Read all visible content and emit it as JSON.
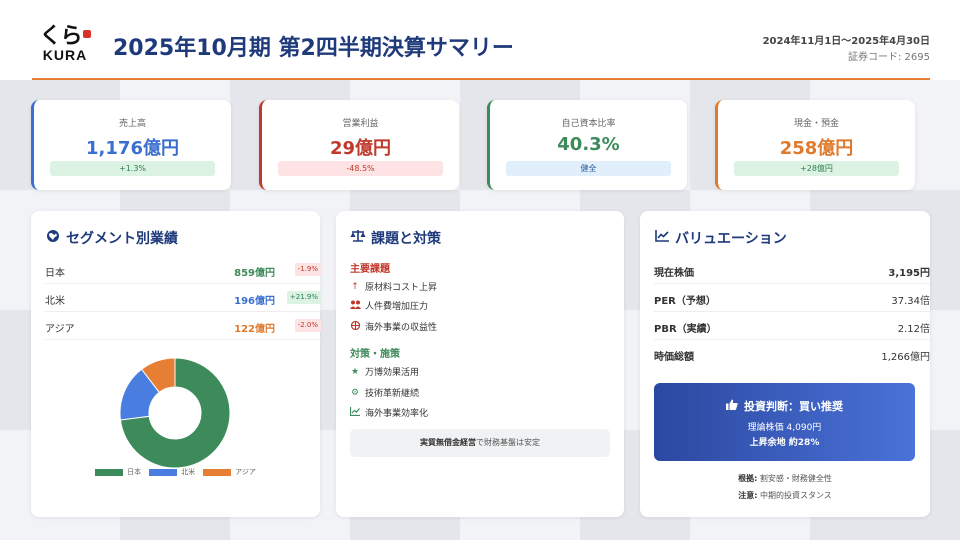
{
  "header": {
    "logo_mark": "くら",
    "logo_word": "KURA",
    "title": "2025年10月期 第2四半期決算サマリー",
    "period": "2024年11月1日～2025年4月30日",
    "code": "証券コード: 2695"
  },
  "kpis": [
    {
      "label": "売上高",
      "value": "1,176億円",
      "badge": "+1.3%",
      "color": "#3b6fcf"
    },
    {
      "label": "営業利益",
      "value": "29億円",
      "badge": "-48.5%",
      "color": "#c0392b"
    },
    {
      "label": "自己資本比率",
      "value": "40.3%",
      "badge": "健全",
      "color": "#3d8b5a"
    },
    {
      "label": "現金・預金",
      "value": "258億円",
      "badge": "+28億円",
      "color": "#e07a2c"
    }
  ],
  "segments": {
    "title": "セグメント別業績",
    "rows": [
      {
        "name": "日本",
        "amount": "859億円",
        "change": "-1.9%",
        "color": "#3d8b5a"
      },
      {
        "name": "北米",
        "amount": "196億円",
        "change": "+21.9%",
        "color": "#3b6fcf"
      },
      {
        "name": "アジア",
        "amount": "122億円",
        "change": "-2.0%",
        "color": "#e07a2c"
      }
    ]
  },
  "chart_data": {
    "type": "pie",
    "categories": [
      "日本",
      "北米",
      "アジア"
    ],
    "values": [
      859,
      196,
      122
    ],
    "colors": [
      "#3d8b5a",
      "#4a7de0",
      "#e67e33"
    ],
    "legend": "bottom"
  },
  "issues": {
    "title": "課題と対策",
    "problems_head": "主要課題",
    "problems": [
      "原材料コスト上昇",
      "人件費増加圧力",
      "海外事業の収益性"
    ],
    "measures_head": "対策・施策",
    "measures": [
      "万博効果活用",
      "技術革新継続",
      "海外事業効率化"
    ],
    "note_bold": "実質無借金経営",
    "note_rest": "で財務基盤は安定"
  },
  "valuation": {
    "title": "バリュエーション",
    "rows": [
      {
        "k": "現在株価",
        "v": "3,195円",
        "bold": true
      },
      {
        "k": "PER（予想）",
        "v": "37.34倍",
        "bold": false
      },
      {
        "k": "PBR（実績）",
        "v": "2.12倍",
        "bold": false
      },
      {
        "k": "時価総額",
        "v": "1,266億円",
        "bold": false
      }
    ],
    "verdict": "投資判断：買い推奨",
    "target": "理論株価 4,090円",
    "upside": "上昇余地 約28%",
    "basis_label": "根拠:",
    "basis": "割安感・財務健全性",
    "caution_label": "注意:",
    "caution": "中期的投資スタンス"
  }
}
